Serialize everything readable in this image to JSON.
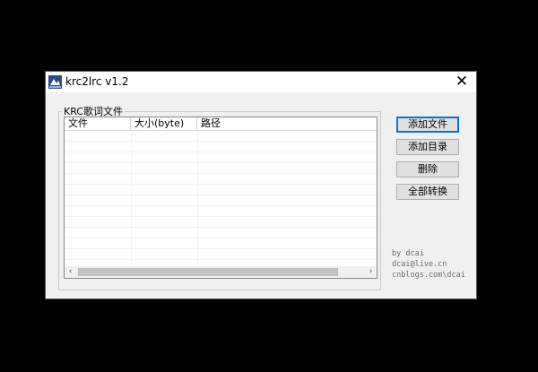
{
  "window": {
    "title": "krc2lrc v1.2",
    "close_glyph": "✕"
  },
  "group": {
    "label": "KRC歌词文件"
  },
  "list": {
    "columns": [
      "文件",
      "大小(byte)",
      "路径"
    ],
    "rows": [],
    "scroll_left": "‹",
    "scroll_right": "›"
  },
  "buttons": {
    "add_file": "添加文件",
    "add_dir": "添加目录",
    "delete": "删除",
    "convert_all": "全部转换"
  },
  "credits": {
    "line1": "by dcai",
    "line2": "dcai@live.cn",
    "line3": "cnblogs.com\\dcai"
  },
  "colors": {
    "accent": "#0078d7",
    "background": "#000000",
    "window": "#f0f0f0"
  }
}
